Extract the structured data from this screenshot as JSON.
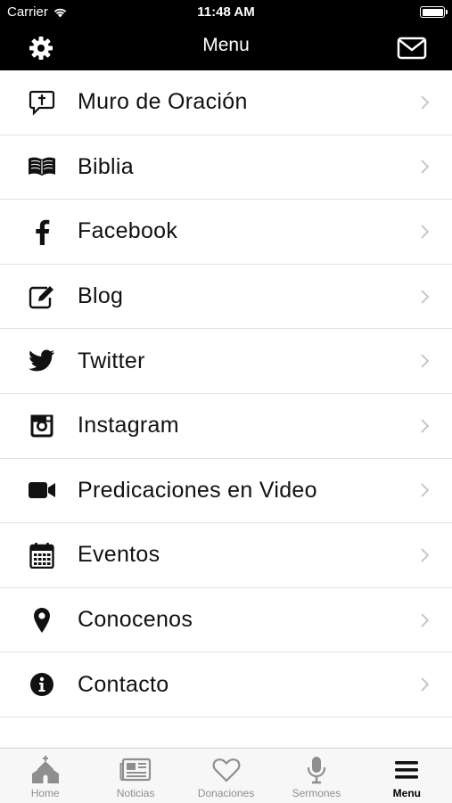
{
  "status_bar": {
    "carrier": "Carrier",
    "time": "11:48 AM"
  },
  "navbar": {
    "title": "Menu"
  },
  "menu": [
    {
      "label": "Muro de Oración",
      "icon": "prayer-wall-icon"
    },
    {
      "label": "Biblia",
      "icon": "bible-icon"
    },
    {
      "label": "Facebook",
      "icon": "facebook-icon"
    },
    {
      "label": "Blog",
      "icon": "blog-edit-icon"
    },
    {
      "label": "Twitter",
      "icon": "twitter-icon"
    },
    {
      "label": "Instagram",
      "icon": "instagram-icon"
    },
    {
      "label": "Predicaciones en Video",
      "icon": "video-camera-icon"
    },
    {
      "label": "Eventos",
      "icon": "calendar-icon"
    },
    {
      "label": "Conocenos",
      "icon": "location-pin-icon"
    },
    {
      "label": "Contacto",
      "icon": "info-icon"
    }
  ],
  "tabbar": [
    {
      "label": "Home",
      "icon": "church-icon",
      "active": false
    },
    {
      "label": "Noticias",
      "icon": "newspaper-icon",
      "active": false
    },
    {
      "label": "Donaciones",
      "icon": "heart-icon",
      "active": false
    },
    {
      "label": "Sermones",
      "icon": "microphone-icon",
      "active": false
    },
    {
      "label": "Menu",
      "icon": "hamburger-icon",
      "active": true
    }
  ],
  "colors": {
    "bar_bg": "#000000",
    "inactive_tab": "#8e8e8e",
    "separator": "#e2e2e2"
  }
}
